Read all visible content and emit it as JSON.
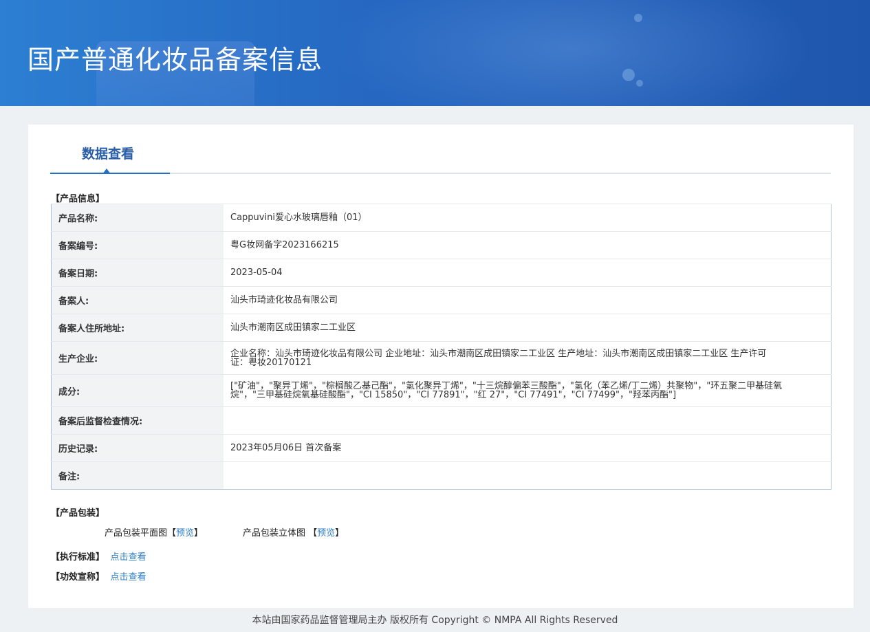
{
  "header": {
    "title": "国产普通化妆品备案信息"
  },
  "tabs": [
    {
      "label": "数据查看"
    }
  ],
  "product_info": {
    "section_title": "【产品信息】",
    "rows": [
      {
        "label": "产品名称:",
        "value": "Cappuvini爱心水玻璃唇釉（01）"
      },
      {
        "label": "备案编号:",
        "value": "粤G妆网备字2023166215"
      },
      {
        "label": "备案日期:",
        "value": "2023-05-04"
      },
      {
        "label": "备案人:",
        "value": "汕头市琦迹化妆品有限公司"
      },
      {
        "label": "备案人住所地址:",
        "value": "汕头市潮南区成田镇家二工业区"
      },
      {
        "label": "生产企业:",
        "value": "企业名称：汕头市琦迹化妆品有限公司 企业地址：汕头市潮南区成田镇家二工业区 生产地址：汕头市潮南区成田镇家二工业区 生产许可证：粤妆20170121"
      },
      {
        "label": "成分:",
        "value": "[\"矿油\"，\"聚异丁烯\"，\"棕榈酸乙基己酯\"，\"氢化聚异丁烯\"，\"十三烷醇偏苯三酸酯\"，\"氢化（苯乙烯/丁二烯）共聚物\"，\"环五聚二甲基硅氧烷\"，\"三甲基硅烷氧基硅酸酯\"，\"CI 15850\"，\"CI 77891\"，\"红 27\"，\"CI 77491\"，\"CI 77499\"，\"羟苯丙酯\"]"
      },
      {
        "label": "备案后监督检查情况:",
        "value": ""
      },
      {
        "label": "历史记录:",
        "value": "2023年05月06日 首次备案"
      },
      {
        "label": "备注:",
        "value": ""
      }
    ]
  },
  "packaging": {
    "section_title": "【产品包装】",
    "flat_label": "产品包装平面图",
    "flat_preview": "预览",
    "threed_label": "产品包装立体图",
    "threed_preview": "预览"
  },
  "standard": {
    "section_title": "【执行标准】",
    "link": "点击查看"
  },
  "efficacy": {
    "section_title": "【功效宣称】",
    "link": "点击查看"
  },
  "footer": {
    "text": "本站由国家药品监督管理局主办 版权所有 Copyright © NMPA All Rights Reserved"
  },
  "colors": {
    "banner": "#2566c0",
    "accent": "#2470c4",
    "link": "#2a7bc6"
  }
}
